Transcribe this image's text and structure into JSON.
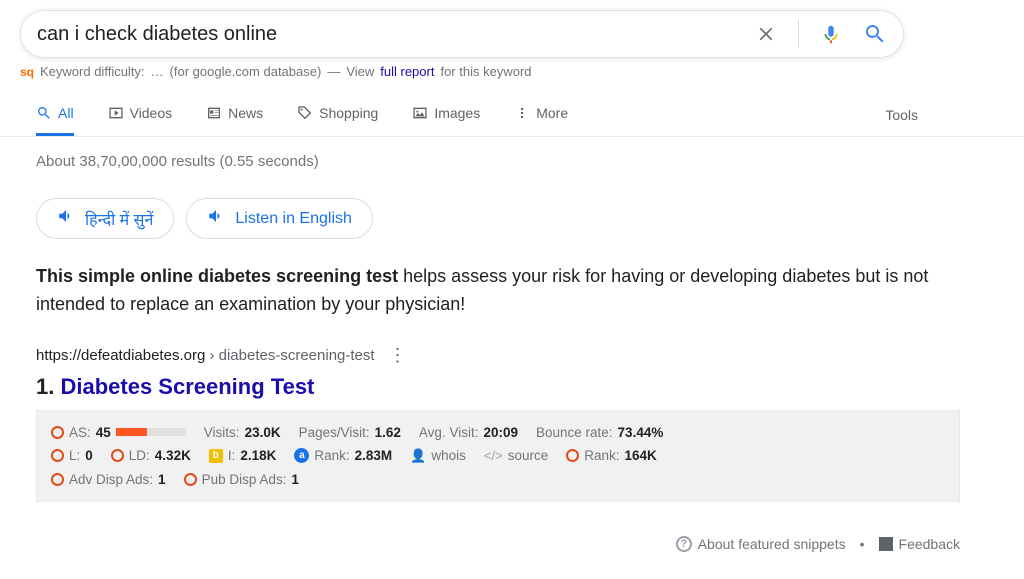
{
  "search": {
    "query": "can i check diabetes online"
  },
  "kd_row": {
    "badge": "sq",
    "label": "Keyword difficulty:",
    "loading": "…",
    "db": "(for google.com database)",
    "sep": "—",
    "view": "View",
    "link": "full report",
    "tail": "for this keyword"
  },
  "tabs": {
    "all": "All",
    "videos": "Videos",
    "news": "News",
    "shopping": "Shopping",
    "images": "Images",
    "more": "More",
    "tools": "Tools"
  },
  "stats": "About 38,70,00,000 results (0.55 seconds)",
  "listen": {
    "hindi": "हिन्दी में सुनें",
    "english": "Listen in English"
  },
  "snippet": {
    "bold": "This simple online diabetes screening test",
    "rest": " helps assess your risk for having or developing diabetes but is not intended to replace an examination by your physician!"
  },
  "cite": {
    "host": "https://defeatdiabetes.org",
    "path": " › diabetes-screening-test"
  },
  "result": {
    "num": "1.",
    "title": "Diabetes Screening Test"
  },
  "seo": {
    "as_lbl": "AS:",
    "as_val": "45",
    "visits_lbl": "Visits:",
    "visits_val": "23.0K",
    "pv_lbl": "Pages/Visit:",
    "pv_val": "1.62",
    "avg_lbl": "Avg. Visit:",
    "avg_val": "20:09",
    "bounce_lbl": "Bounce rate:",
    "bounce_val": "73.44%",
    "l_lbl": "L:",
    "l_val": "0",
    "ld_lbl": "LD:",
    "ld_val": "4.32K",
    "bing_lbl": "I:",
    "bing_val": "2.18K",
    "rank_lbl": "Rank:",
    "rank_val": "2.83M",
    "whois": "whois",
    "source": "source",
    "rank2_lbl": "Rank:",
    "rank2_val": "164K",
    "adv_lbl": "Adv Disp Ads:",
    "adv_val": "1",
    "pub_lbl": "Pub Disp Ads:",
    "pub_val": "1"
  },
  "footer": {
    "about": "About featured snippets",
    "feedback": "Feedback"
  }
}
